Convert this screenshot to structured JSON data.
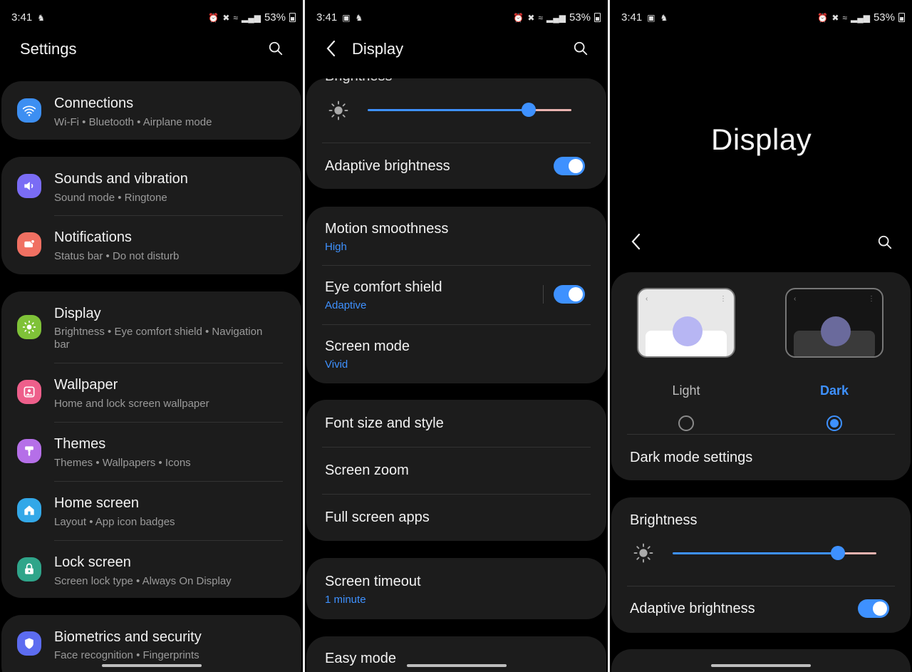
{
  "status_left": {
    "p1": "3:41",
    "p2": "3:41",
    "p3": "3:41"
  },
  "status_right": {
    "battery": "53%"
  },
  "settings": {
    "title": "Settings",
    "items": [
      {
        "title": "Connections",
        "sub": "Wi-Fi  •  Bluetooth  •  Airplane mode",
        "icon": "wifi-icon",
        "color": "#3d8ff2"
      },
      {
        "title": "Sounds and vibration",
        "sub": "Sound mode  •  Ringtone",
        "icon": "volume-icon",
        "color": "#7a6cf5"
      },
      {
        "title": "Notifications",
        "sub": "Status bar  •  Do not disturb",
        "icon": "notification-icon",
        "color": "#f07062"
      },
      {
        "title": "Display",
        "sub": "Brightness  •  Eye comfort shield  •  Navigation",
        "sub2": "bar",
        "icon": "sun-icon",
        "color": "#7fc238"
      },
      {
        "title": "Wallpaper",
        "sub": "Home and lock screen wallpaper",
        "icon": "image-icon",
        "color": "#ee5f8b"
      },
      {
        "title": "Themes",
        "sub": "Themes  •  Wallpapers  •  Icons",
        "icon": "brush-icon",
        "color": "#b56fe8"
      },
      {
        "title": "Home screen",
        "sub": "Layout  •  App icon badges",
        "icon": "home-icon",
        "color": "#33a8e8"
      },
      {
        "title": "Lock screen",
        "sub": "Screen lock type  •  Always On Display",
        "icon": "lock-icon",
        "color": "#2fa58a"
      },
      {
        "title": "Biometrics and security",
        "sub": "Face recognition  •  Fingerprints",
        "icon": "shield-icon",
        "color": "#5c6cf0"
      }
    ]
  },
  "display": {
    "title": "Display",
    "brightness_label": "Brightness",
    "brightness_level": 0.79,
    "adaptive_brightness": "Adaptive brightness",
    "motion_smoothness": {
      "title": "Motion smoothness",
      "value": "High"
    },
    "eye_comfort": {
      "title": "Eye comfort shield",
      "value": "Adaptive"
    },
    "screen_mode": {
      "title": "Screen mode",
      "value": "Vivid"
    },
    "font_size": "Font size and style",
    "screen_zoom": "Screen zoom",
    "full_screen_apps": "Full screen apps",
    "screen_timeout": {
      "title": "Screen timeout",
      "value": "1 minute"
    },
    "easy_mode": "Easy mode"
  },
  "display_dark": {
    "big_title": "Display",
    "light_label": "Light",
    "dark_label": "Dark",
    "dark_mode_settings": "Dark mode settings",
    "brightness_label": "Brightness",
    "brightness_level": 0.81,
    "adaptive_brightness": "Adaptive brightness"
  },
  "colors": {
    "accent": "#3e91ff",
    "card": "#1c1c1c",
    "background": "#000000"
  }
}
